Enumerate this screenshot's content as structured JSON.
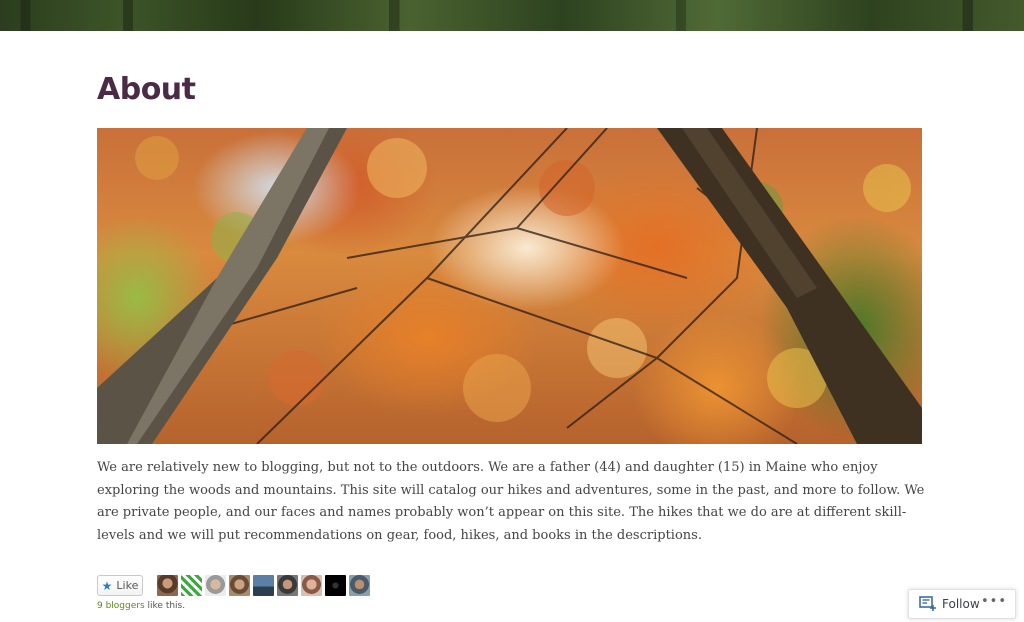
{
  "page": {
    "title": "About"
  },
  "content": {
    "paragraph": "We are relatively new to blogging, but not to the outdoors.  We are a father (44) and daughter (15) in Maine who enjoy exploring the woods and mountains.  This site will catalog our hikes and adventures, some in the past, and more to follow.  We are private people, and our faces and names probably won’t appear on this site. The hikes that we do are at different skill-levels and we will put recommendations on gear, food, hikes, and books in the descriptions."
  },
  "likes": {
    "button_label": "Like",
    "count_link": "9 bloggers",
    "count_suffix": " like this."
  },
  "footer_bar": {
    "follow_label": "Follow",
    "more_label": "•••"
  },
  "colors": {
    "title": "#4a2a44",
    "link": "#5a8a1c",
    "like_star": "#2e7dbf"
  },
  "icons": {
    "like": "star-icon",
    "follow": "reader-follow-icon",
    "more": "ellipsis-icon"
  }
}
